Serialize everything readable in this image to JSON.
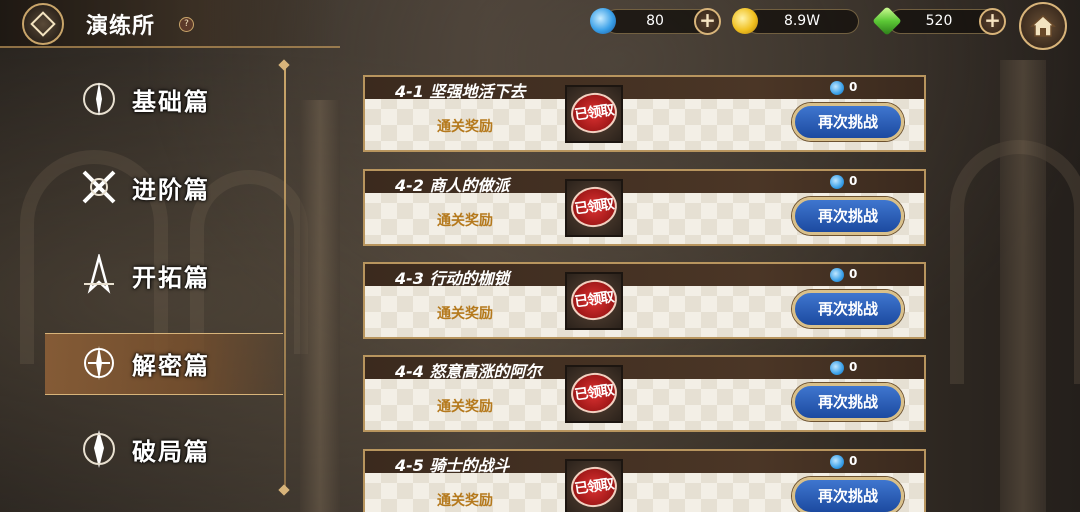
{
  "header": {
    "title": "演练所",
    "help_symbol": "?"
  },
  "resources": [
    {
      "name": "water-drop",
      "value": "80"
    },
    {
      "name": "gold-coin",
      "value": "8.9W"
    },
    {
      "name": "green-gem",
      "value": "520"
    }
  ],
  "sidebar": {
    "items": [
      {
        "label": "基础篇"
      },
      {
        "label": "进阶篇"
      },
      {
        "label": "开拓篇"
      },
      {
        "label": "解密篇",
        "active": true
      },
      {
        "label": "破局篇"
      }
    ]
  },
  "levels": [
    {
      "title": "4-1 坚强地活下去",
      "cost": "0",
      "reward_label": "通关奖励",
      "stamp": "已领取",
      "button": "再次挑战"
    },
    {
      "title": "4-2 商人的做派",
      "cost": "0",
      "reward_label": "通关奖励",
      "stamp": "已领取",
      "button": "再次挑战"
    },
    {
      "title": "4-3 行动的枷锁",
      "cost": "0",
      "reward_label": "通关奖励",
      "stamp": "已领取",
      "button": "再次挑战"
    },
    {
      "title": "4-4 怒意高涨的阿尔",
      "cost": "0",
      "reward_label": "通关奖励",
      "stamp": "已领取",
      "button": "再次挑战"
    },
    {
      "title": "4-5 骑士的战斗",
      "cost": "0",
      "reward_label": "通关奖励",
      "stamp": "已领取",
      "button": "再次挑战"
    }
  ],
  "colors": {
    "accent_gold": "#c9a56a",
    "button_blue": "#2a5cb8",
    "stamp_red": "#c21f1f"
  }
}
